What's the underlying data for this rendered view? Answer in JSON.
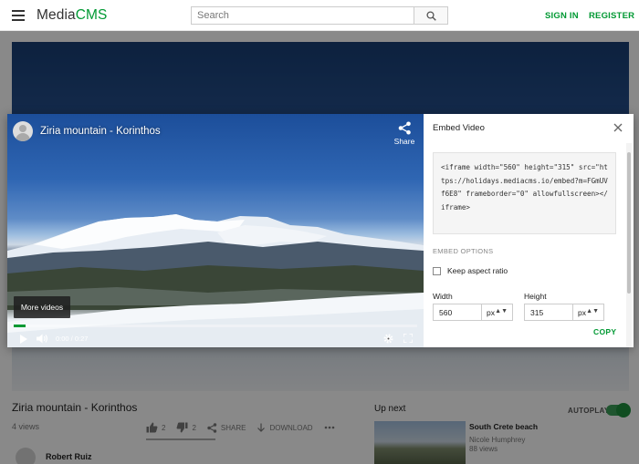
{
  "header": {
    "logo_main": "Media",
    "logo_accent": "CMS",
    "search_placeholder": "Search",
    "sign_in": "SIGN IN",
    "register": "REGISTER"
  },
  "video": {
    "title": "Ziria mountain - Korinthos",
    "views": "4 views",
    "likes": "2",
    "dislikes": "2",
    "share": "SHARE",
    "download": "DOWNLOAD",
    "author": "Robert Ruiz"
  },
  "sidebar": {
    "up_next": "Up next",
    "autoplay": "AUTOPLAY",
    "next_title": "South Crete beach",
    "next_author": "Nicole Humphrey",
    "next_views": "88 views"
  },
  "player": {
    "title": "Ziria mountain - Korinthos",
    "share_label": "Share",
    "more_videos": "More videos",
    "time": "0:00 / 0:27",
    "progress": 0.03
  },
  "embed": {
    "title": "Embed Video",
    "code": "<iframe width=\"560\" height=\"315\" src=\"https://holidays.mediacms.io/embed?m=FGmUVf6E8\" frameborder=\"0\" allowfullscreen></iframe>",
    "options_label": "EMBED OPTIONS",
    "keep_aspect_label": "Keep aspect ratio",
    "width_label": "Width",
    "height_label": "Height",
    "width_value": "560",
    "height_value": "315",
    "unit": "px",
    "copy": "COPY"
  },
  "colors": {
    "accent": "#009933",
    "overlay": "rgba(0,0,0,0.45)"
  }
}
